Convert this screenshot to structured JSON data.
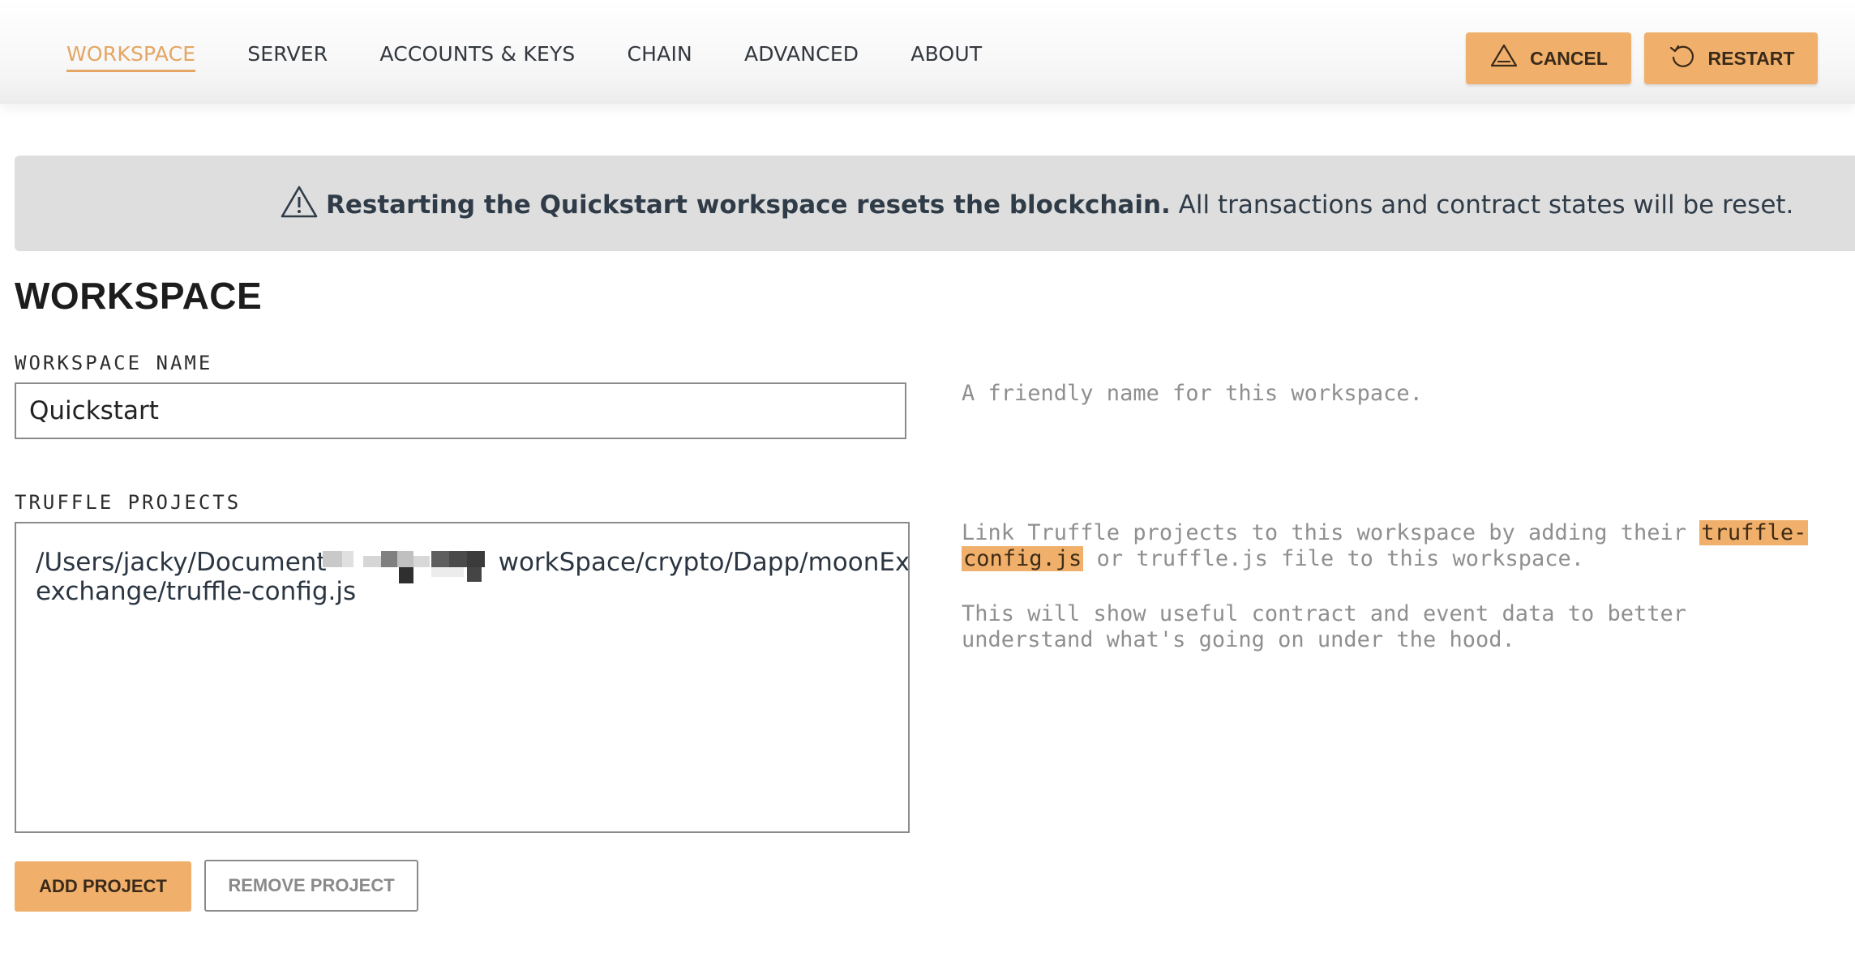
{
  "nav": {
    "tabs": [
      {
        "label": "WORKSPACE",
        "active": true
      },
      {
        "label": "SERVER"
      },
      {
        "label": "ACCOUNTS & KEYS"
      },
      {
        "label": "CHAIN"
      },
      {
        "label": "ADVANCED"
      },
      {
        "label": "ABOUT"
      }
    ]
  },
  "toolbar": {
    "cancel_label": "CANCEL",
    "cancel_icon": "warning-triangle-icon",
    "restart_label": "RESTART",
    "restart_icon": "restart-icon"
  },
  "banner": {
    "icon": "warning-triangle-icon",
    "bold_text": "Restarting the Quickstart workspace resets the blockchain.",
    "text": " All transactions and contract states will be reset."
  },
  "workspace": {
    "title": "WORKSPACE",
    "name_label": "WORKSPACE NAME",
    "name_value": "Quickstart",
    "name_help": "A friendly name for this workspace.",
    "projects_label": "TRUFFLE PROJECTS",
    "project_path_line1_start": "/Users/jacky/Document",
    "project_path_line1_end": "workSpace/crypto/Dapp/moonExch",
    "project_path_line2": "exchange/truffle-config.js",
    "projects_help": {
      "part1": "Link Truffle projects to this workspace by adding their ",
      "highlight1": "truffle-",
      "highlight2": "config.js",
      "part2": " or truffle.js file to this workspace.",
      "para2_line1": "This will show useful contract and event data to better",
      "para2_line2": "understand what's going on under the hood."
    },
    "add_project_label": "ADD PROJECT",
    "remove_project_label": "REMOVE PROJECT"
  },
  "colors": {
    "accent": "#f0b06b",
    "active_tab": "#e4a663",
    "banner_bg": "#dedede"
  }
}
